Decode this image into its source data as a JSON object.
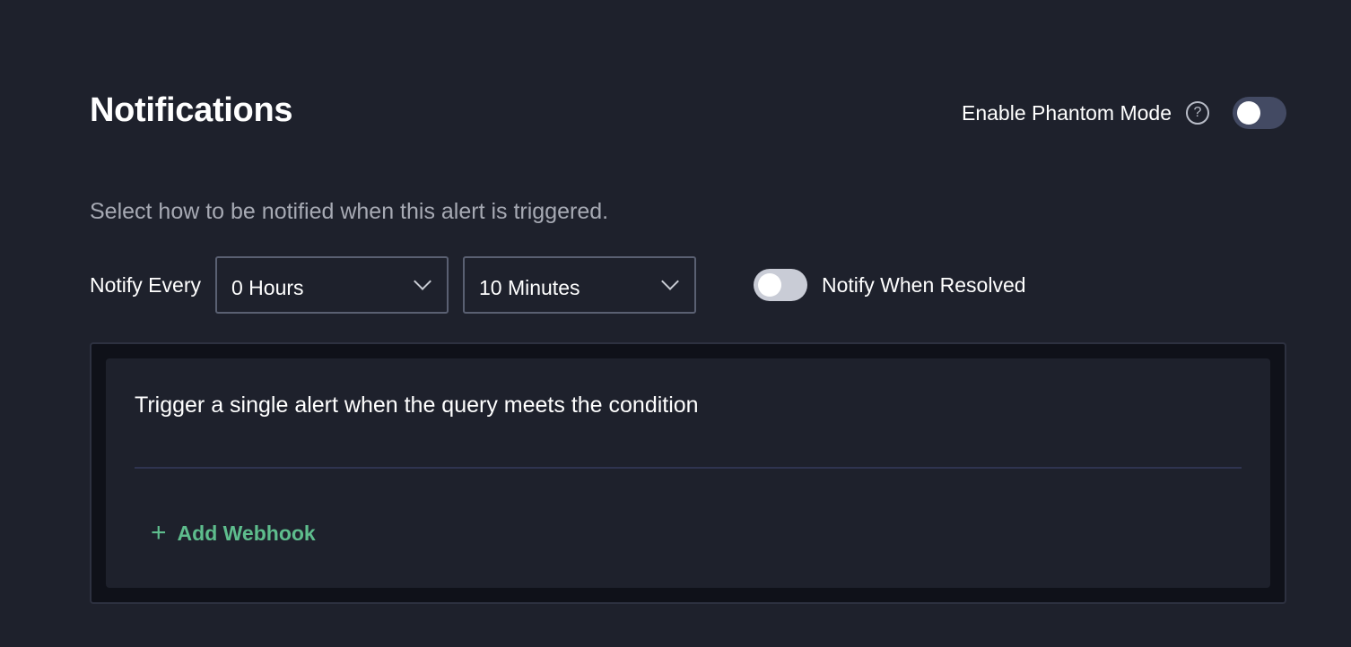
{
  "header": {
    "title": "Notifications",
    "phantom_mode_label": "Enable Phantom Mode",
    "phantom_mode_enabled": false,
    "help_icon": "question-circle-icon"
  },
  "subtitle": "Select how to be notified when this alert is triggered.",
  "notify": {
    "label": "Notify Every",
    "hours_value": "0 Hours",
    "minutes_value": "10 Minutes",
    "resolved_label": "Notify When Resolved",
    "resolved_enabled": false
  },
  "condition_card": {
    "title": "Trigger a single alert when the query meets the condition",
    "add_webhook_label": "Add Webhook",
    "add_icon": "plus-icon"
  },
  "colors": {
    "background": "#1e212c",
    "accent_green": "#5ebd8d",
    "toggle_off_dark": "#434a63",
    "toggle_off_light": "#c9ccd6"
  }
}
